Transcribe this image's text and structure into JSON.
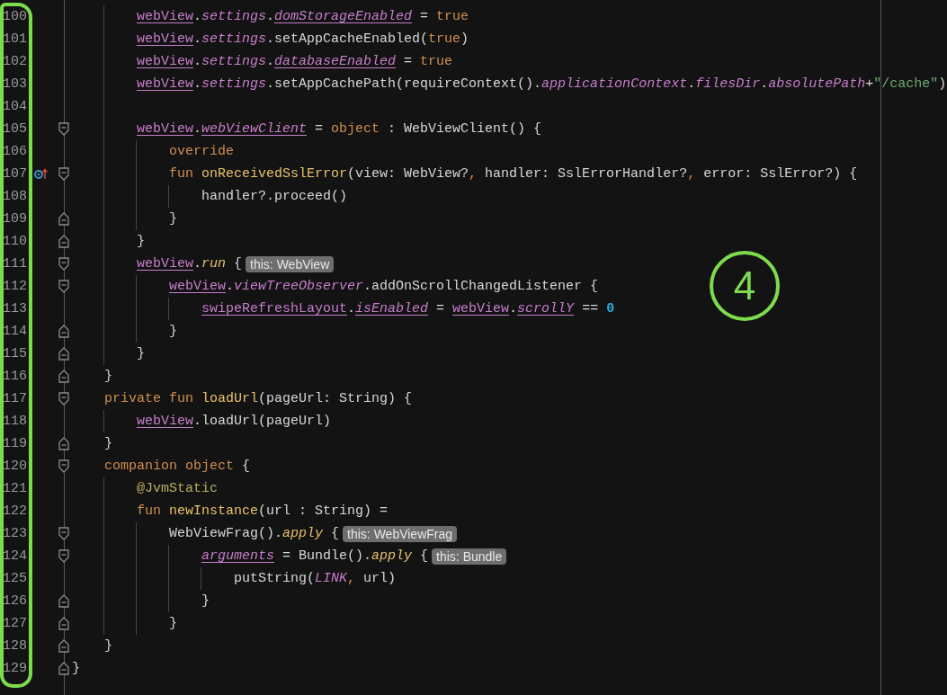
{
  "editor": {
    "lines": [
      {
        "children": [
          {
            "children": [
              {
                "number": "100",
                "tokens": [
                  {
                    "t": "webView",
                    "kind": "field"
                  },
                  {
                    "t": ".",
                    "kind": "plain"
                  },
                  {
                    "t": "settings",
                    "kind": "property"
                  },
                  {
                    "t": ".",
                    "kind": "plain"
                  },
                  {
                    "t": "domStorageEnabled",
                    "kind": "synthetic"
                  },
                  {
                    "t": " = ",
                    "kind": "plain"
                  },
                  {
                    "t": "true",
                    "kind": "keyword"
                  }
                ]
              },
              {
                "number": "101",
                "tokens": [
                  {
                    "t": "webView",
                    "kind": "field"
                  },
                  {
                    "t": ".",
                    "kind": "plain"
                  },
                  {
                    "t": "settings",
                    "kind": "property"
                  },
                  {
                    "t": ".setAppCacheEnabled(",
                    "kind": "plain"
                  },
                  {
                    "t": "true",
                    "kind": "keyword"
                  },
                  {
                    "t": ")",
                    "kind": "plain"
                  }
                ]
              },
              {
                "number": "102",
                "tokens": [
                  {
                    "t": "webView",
                    "kind": "field"
                  },
                  {
                    "t": ".",
                    "kind": "plain"
                  },
                  {
                    "t": "settings",
                    "kind": "property"
                  },
                  {
                    "t": ".",
                    "kind": "plain"
                  },
                  {
                    "t": "databaseEnabled",
                    "kind": "synthetic"
                  },
                  {
                    "t": " = ",
                    "kind": "plain"
                  },
                  {
                    "t": "true",
                    "kind": "keyword"
                  }
                ]
              },
              {
                "number": "103",
                "tokens": [
                  {
                    "t": "webView",
                    "kind": "field"
                  },
                  {
                    "t": ".",
                    "kind": "plain"
                  },
                  {
                    "t": "settings",
                    "kind": "property"
                  },
                  {
                    "t": ".setAppCachePath(requireContext().",
                    "kind": "plain"
                  },
                  {
                    "t": "applicationContext",
                    "kind": "property"
                  },
                  {
                    "t": ".",
                    "kind": "plain"
                  },
                  {
                    "t": "filesDir",
                    "kind": "property"
                  },
                  {
                    "t": ".",
                    "kind": "plain"
                  },
                  {
                    "t": "absolutePath",
                    "kind": "property"
                  },
                  {
                    "t": "+",
                    "kind": "plain"
                  },
                  {
                    "t": "\"/cache\"",
                    "kind": "string"
                  },
                  {
                    "t": ")",
                    "kind": "plain"
                  }
                ]
              },
              {
                "number": "104"
              },
              {
                "number": "105",
                "fold": {
                  "kind": "start"
                },
                "tokens": [
                  {
                    "t": "webView",
                    "kind": "field"
                  },
                  {
                    "t": ".",
                    "kind": "plain"
                  },
                  {
                    "t": "webViewClient",
                    "kind": "synthetic"
                  },
                  {
                    "t": " = ",
                    "kind": "plain"
                  },
                  {
                    "t": "object",
                    "kind": "keyword"
                  },
                  {
                    "t": " : WebViewClient() {",
                    "kind": "plain"
                  }
                ],
                "children": [
                  {
                    "number": "106",
                    "tokens": [
                      {
                        "t": "override",
                        "kind": "keyword"
                      }
                    ]
                  },
                  {
                    "number": "107",
                    "fold": {
                      "kind": "start"
                    },
                    "marker": {
                      "kind": "override"
                    },
                    "tokens": [
                      {
                        "t": "fun ",
                        "kind": "keyword"
                      },
                      {
                        "t": "onReceivedSslError",
                        "kind": "function"
                      },
                      {
                        "t": "(view: WebView?",
                        "kind": "plain"
                      },
                      {
                        "t": ",",
                        "kind": "keyword"
                      },
                      {
                        "t": " handler: SslErrorHandler?",
                        "kind": "plain"
                      },
                      {
                        "t": ",",
                        "kind": "keyword"
                      },
                      {
                        "t": " error: SslError?) {",
                        "kind": "plain"
                      }
                    ],
                    "children": [
                      {
                        "number": "108",
                        "tokens": [
                          {
                            "t": "handler?.proceed()",
                            "kind": "plain"
                          }
                        ]
                      }
                    ]
                  },
                  {
                    "number": "109",
                    "fold": {
                      "kind": "end"
                    },
                    "tokens": [
                      {
                        "t": "}",
                        "kind": "plain"
                      }
                    ]
                  }
                ]
              },
              {
                "number": "110",
                "fold": {
                  "kind": "end"
                },
                "tokens": [
                  {
                    "t": "}",
                    "kind": "plain"
                  }
                ]
              },
              {
                "number": "111",
                "fold": {
                  "kind": "start"
                },
                "hint": "this: WebView",
                "tokens": [
                  {
                    "t": "webView",
                    "kind": "field"
                  },
                  {
                    "t": ".",
                    "kind": "plain"
                  },
                  {
                    "t": "run",
                    "kind": "ext-call"
                  },
                  {
                    "t": " {",
                    "kind": "plain"
                  }
                ],
                "children": [
                  {
                    "number": "112",
                    "fold": {
                      "kind": "start"
                    },
                    "tokens": [
                      {
                        "t": "webView",
                        "kind": "field"
                      },
                      {
                        "t": ".",
                        "kind": "plain"
                      },
                      {
                        "t": "viewTreeObserver",
                        "kind": "property"
                      },
                      {
                        "t": ".addOnScrollChangedListener {",
                        "kind": "plain"
                      }
                    ],
                    "children": [
                      {
                        "number": "113",
                        "tokens": [
                          {
                            "t": "swipeRefreshLayout",
                            "kind": "field"
                          },
                          {
                            "t": ".",
                            "kind": "plain"
                          },
                          {
                            "t": "isEnabled",
                            "kind": "synthetic"
                          },
                          {
                            "t": " = ",
                            "kind": "plain"
                          },
                          {
                            "t": "webView",
                            "kind": "field"
                          },
                          {
                            "t": ".",
                            "kind": "plain"
                          },
                          {
                            "t": "scrollY",
                            "kind": "synthetic"
                          },
                          {
                            "t": " == ",
                            "kind": "plain"
                          },
                          {
                            "t": "0",
                            "kind": "number"
                          }
                        ]
                      }
                    ]
                  },
                  {
                    "number": "114",
                    "fold": {
                      "kind": "end"
                    },
                    "tokens": [
                      {
                        "t": "}",
                        "kind": "plain"
                      }
                    ]
                  }
                ]
              },
              {
                "number": "115",
                "fold": {
                  "kind": "end"
                },
                "tokens": [
                  {
                    "t": "}",
                    "kind": "plain"
                  }
                ]
              }
            ]
          },
          {
            "number": "116",
            "fold": {
              "kind": "end"
            },
            "tokens": [
              {
                "t": "}",
                "kind": "plain"
              }
            ]
          },
          {
            "number": "117",
            "fold": {
              "kind": "start"
            },
            "tokens": [
              {
                "t": "private fun ",
                "kind": "keyword"
              },
              {
                "t": "loadUrl",
                "kind": "function"
              },
              {
                "t": "(pageUrl: String) {",
                "kind": "plain"
              }
            ],
            "children": [
              {
                "number": "118",
                "tokens": [
                  {
                    "t": "webView",
                    "kind": "field"
                  },
                  {
                    "t": ".loadUrl(pageUrl)",
                    "kind": "plain"
                  }
                ]
              }
            ]
          },
          {
            "number": "119",
            "fold": {
              "kind": "end"
            },
            "tokens": [
              {
                "t": "}",
                "kind": "plain"
              }
            ]
          },
          {
            "number": "120",
            "fold": {
              "kind": "start"
            },
            "tokens": [
              {
                "t": "companion object",
                "kind": "keyword"
              },
              {
                "t": " {",
                "kind": "plain"
              }
            ],
            "children": [
              {
                "number": "121",
                "tokens": [
                  {
                    "t": "@JvmStatic",
                    "kind": "annotation"
                  }
                ]
              },
              {
                "number": "122",
                "tokens": [
                  {
                    "t": "fun ",
                    "kind": "keyword"
                  },
                  {
                    "t": "newInstance",
                    "kind": "function"
                  },
                  {
                    "t": "(url : String) =",
                    "kind": "plain"
                  }
                ],
                "children": [
                  {
                    "number": "123",
                    "fold": {
                      "kind": "start"
                    },
                    "hint": "this: WebViewFrag",
                    "tokens": [
                      {
                        "t": "WebViewFrag().",
                        "kind": "plain"
                      },
                      {
                        "t": "apply",
                        "kind": "ext-call"
                      },
                      {
                        "t": " {",
                        "kind": "plain"
                      }
                    ],
                    "children": [
                      {
                        "number": "124",
                        "fold": {
                          "kind": "start"
                        },
                        "hint": "this: Bundle",
                        "tokens": [
                          {
                            "t": "arguments",
                            "kind": "synthetic"
                          },
                          {
                            "t": " = Bundle().",
                            "kind": "plain"
                          },
                          {
                            "t": "apply",
                            "kind": "ext-call"
                          },
                          {
                            "t": " {",
                            "kind": "plain"
                          }
                        ],
                        "children": [
                          {
                            "number": "125",
                            "tokens": [
                              {
                                "t": "putString(",
                                "kind": "plain"
                              },
                              {
                                "t": "LINK",
                                "kind": "property"
                              },
                              {
                                "t": ",",
                                "kind": "keyword"
                              },
                              {
                                "t": " url)",
                                "kind": "plain"
                              }
                            ]
                          }
                        ]
                      },
                      {
                        "number": "126",
                        "fold": {
                          "kind": "end"
                        },
                        "tokens": [
                          {
                            "t": "}",
                            "kind": "plain"
                          }
                        ]
                      }
                    ]
                  },
                  {
                    "number": "127",
                    "fold": {
                      "kind": "end"
                    },
                    "tokens": [
                      {
                        "t": "}",
                        "kind": "plain"
                      }
                    ]
                  }
                ]
              }
            ]
          },
          {
            "number": "128",
            "fold": {
              "kind": "end"
            },
            "tokens": [
              {
                "t": "}",
                "kind": "plain"
              }
            ]
          }
        ]
      },
      {
        "number": "129",
        "fold": {
          "kind": "end"
        },
        "tokens": [
          {
            "t": "}",
            "kind": "plain"
          }
        ]
      }
    ]
  },
  "callout": {
    "label": "4"
  }
}
